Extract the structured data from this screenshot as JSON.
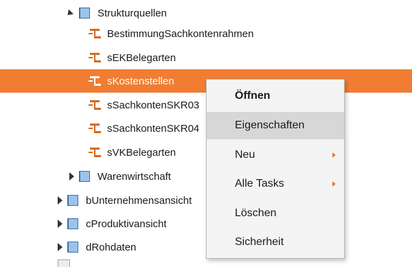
{
  "colors": {
    "selection": "#f07d32",
    "cube_front": "#9dc3e8",
    "cube_side": "#3d6fa8",
    "leaf_icon": "#d3691f"
  },
  "tree": {
    "strukturquellen": {
      "label": "Strukturquellen",
      "icon": "cube-icon"
    },
    "children": [
      {
        "label": "BestimmungSachkontenrahmen",
        "icon": "table-field-icon"
      },
      {
        "label": "sEKBelegarten",
        "icon": "table-field-icon"
      },
      {
        "label": "sKostenstellen",
        "icon": "table-field-icon",
        "selected": true
      },
      {
        "label": "sSachkontenSKR03",
        "icon": "table-field-icon"
      },
      {
        "label": "sSachkontenSKR04",
        "icon": "table-field-icon"
      },
      {
        "label": "sVKBelegarten",
        "icon": "table-field-icon"
      }
    ],
    "warenwirtschaft": {
      "label": "Warenwirtschaft",
      "icon": "cube-icon"
    },
    "top_level": [
      {
        "label": "bUnternehmensansicht",
        "icon": "cube-icon"
      },
      {
        "label": "cProduktivansicht",
        "icon": "cube-icon"
      },
      {
        "label": "dRohdaten",
        "icon": "cube-icon"
      }
    ]
  },
  "context_menu": {
    "items": [
      {
        "label": "Öffnen",
        "bold": true
      },
      {
        "label": "Eigenschaften",
        "hover": true
      },
      {
        "label": "Neu",
        "submenu": true
      },
      {
        "label": "Alle Tasks",
        "submenu": true
      },
      {
        "label": "Löschen"
      },
      {
        "label": "Sicherheit"
      }
    ]
  }
}
